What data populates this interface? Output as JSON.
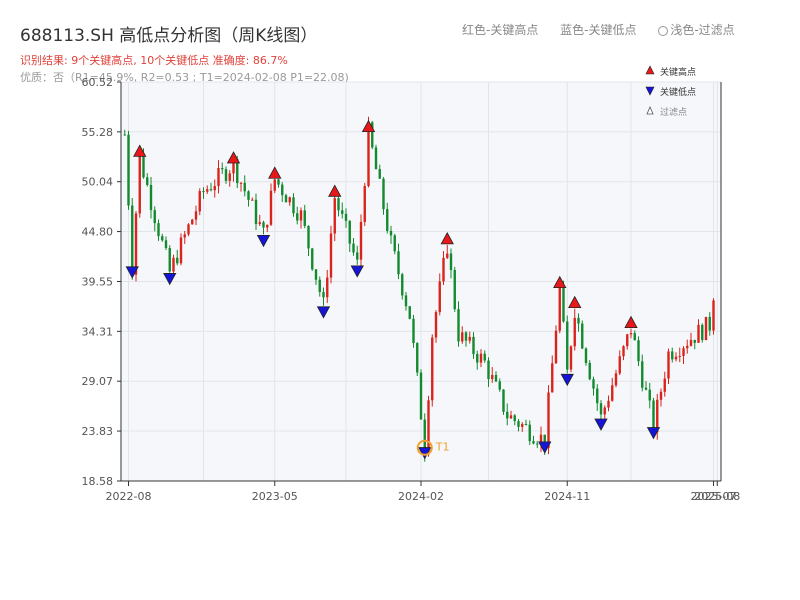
{
  "title": "688113.SH 高低点分析图（周K线图）",
  "subtitle": "识别结果: 9个关键高点, 10个关键低点  准确度: 86.7%",
  "quality": "优质：否（R1=45.9%, R2=0.53 ; T1=2024-02-08 P1=22.08)",
  "top_legend": {
    "high": "红色-关键高点",
    "low": "蓝色-关键低点",
    "filtered": "浅色-过滤点"
  },
  "colors": {
    "up": "#d9231c",
    "down": "#138a2f",
    "high_marker": "#e8181a",
    "low_marker": "#1515d8",
    "t1_marker": "#f0a030",
    "plot_bg": "#f5f7fa",
    "grid": "#e1e5ea"
  },
  "chart_data": {
    "type": "candlestick",
    "y_range": [
      18.58,
      60.52
    ],
    "y_ticks": [
      "60.52",
      "55.28",
      "50.04",
      "44.80",
      "39.55",
      "34.31",
      "29.07",
      "23.83",
      "18.58"
    ],
    "x_ticks": [
      "2022-08",
      "2023-05",
      "2024-02",
      "2024-11",
      "2025-07",
      "2025-08"
    ],
    "legend": {
      "high": "关键高点",
      "low": "关键低点",
      "filtered": "过滤点"
    },
    "t1_label": "T1",
    "anchors": [
      [
        "2022-07-28",
        55.0
      ],
      [
        "2022-08-11",
        41.2
      ],
      [
        "2022-08-25",
        52.6
      ],
      [
        "2022-09-29",
        45.0
      ],
      [
        "2022-10-20",
        40.5
      ],
      [
        "2022-12-22",
        49.0
      ],
      [
        "2023-02-16",
        51.9
      ],
      [
        "2023-04-13",
        44.5
      ],
      [
        "2023-05-04",
        50.3
      ],
      [
        "2023-06-22",
        46.5
      ],
      [
        "2023-08-03",
        37.0
      ],
      [
        "2023-08-24",
        48.4
      ],
      [
        "2023-10-05",
        41.3
      ],
      [
        "2023-10-26",
        55.2
      ],
      [
        "2023-12-07",
        43.5
      ],
      [
        "2024-01-11",
        36.0
      ],
      [
        "2024-02-08",
        22.2
      ],
      [
        "2024-02-22",
        34.0
      ],
      [
        "2024-03-21",
        43.4
      ],
      [
        "2024-04-11",
        34.0
      ],
      [
        "2024-05-30",
        31.0
      ],
      [
        "2024-07-11",
        25.5
      ],
      [
        "2024-09-19",
        22.8
      ],
      [
        "2024-10-17",
        38.8
      ],
      [
        "2024-10-31",
        29.9
      ],
      [
        "2024-11-14",
        36.7
      ],
      [
        "2025-01-02",
        25.2
      ],
      [
        "2025-02-27",
        34.6
      ],
      [
        "2025-04-10",
        24.3
      ],
      [
        "2025-05-08",
        32.0
      ],
      [
        "2025-07-24",
        35.0
      ],
      [
        "2025-08-07",
        41.8
      ]
    ],
    "key_highs": [
      [
        "2022-08-25",
        52.6
      ],
      [
        "2023-02-16",
        51.9
      ],
      [
        "2023-05-04",
        50.3
      ],
      [
        "2023-08-24",
        48.4
      ],
      [
        "2023-10-26",
        55.2
      ],
      [
        "2024-03-21",
        43.4
      ],
      [
        "2024-10-17",
        38.8
      ],
      [
        "2024-11-14",
        36.7
      ],
      [
        "2025-02-27",
        34.6
      ]
    ],
    "key_lows": [
      [
        "2022-08-11",
        41.2
      ],
      [
        "2022-10-20",
        40.5
      ],
      [
        "2023-04-13",
        44.5
      ],
      [
        "2023-08-03",
        37.0
      ],
      [
        "2023-10-05",
        41.3
      ],
      [
        "2024-02-08",
        22.2
      ],
      [
        "2024-09-19",
        22.8
      ],
      [
        "2024-10-31",
        29.9
      ],
      [
        "2025-01-02",
        25.2
      ],
      [
        "2025-04-10",
        24.3
      ]
    ],
    "t1_point": [
      "2024-02-08",
      22.08
    ]
  }
}
